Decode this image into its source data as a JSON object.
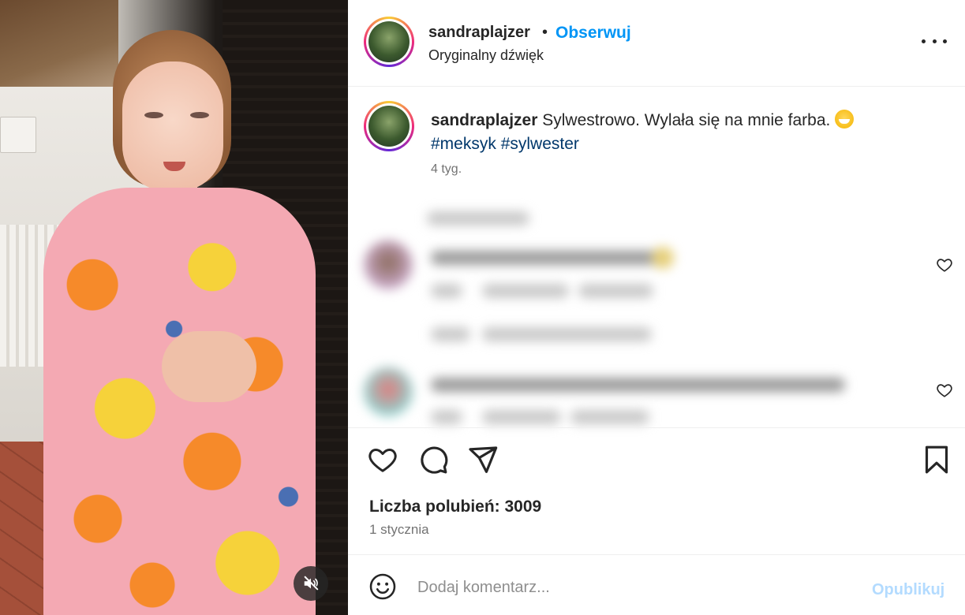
{
  "post": {
    "username": "sandraplajzer",
    "separator": "•",
    "follow_label": "Obserwuj",
    "audio_label": "Oryginalny dźwięk",
    "caption_text": "Sylwestrowo. Wylała się na mnie farba.",
    "hashtags": [
      "#meksyk",
      "#sylwester"
    ],
    "time_ago": "4 tyg.",
    "likes_text": "Liczba polubień: 3009",
    "date": "1 stycznia"
  },
  "comment_box": {
    "placeholder": "Dodaj komentarz...",
    "publish_label": "Opublikuj"
  },
  "icons": {
    "more": "more-options-icon",
    "like": "heart-icon",
    "comment": "comment-icon",
    "share": "send-icon",
    "save": "bookmark-icon",
    "emoji": "emoji-icon",
    "mute": "muted-speaker-icon"
  },
  "colors": {
    "accent": "#0095f6",
    "hashtag": "#00376b",
    "muted_text": "#737373",
    "publish_disabled": "#b3dbff"
  }
}
